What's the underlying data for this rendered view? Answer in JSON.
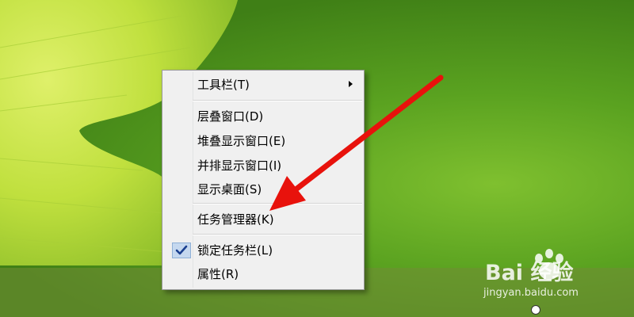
{
  "desktop": {
    "colors": {
      "wallpaper": "#4f8f20",
      "leaf": "#c7e64a",
      "menu_bg": "#f0f0f0",
      "arrow": "#e8120c"
    }
  },
  "context_menu": {
    "items": [
      {
        "label": "工具栏(T)",
        "has_submenu": true
      },
      {
        "label": "层叠窗口(D)"
      },
      {
        "label": "堆叠显示窗口(E)"
      },
      {
        "label": "并排显示窗口(I)"
      },
      {
        "label": "显示桌面(S)"
      },
      {
        "label": "任务管理器(K)"
      },
      {
        "label": "锁定任务栏(L)",
        "checked": true
      },
      {
        "label": "属性(R)"
      }
    ]
  },
  "watermark": {
    "brand": "Bai 经验",
    "url": "jingyan.baidu.com"
  }
}
